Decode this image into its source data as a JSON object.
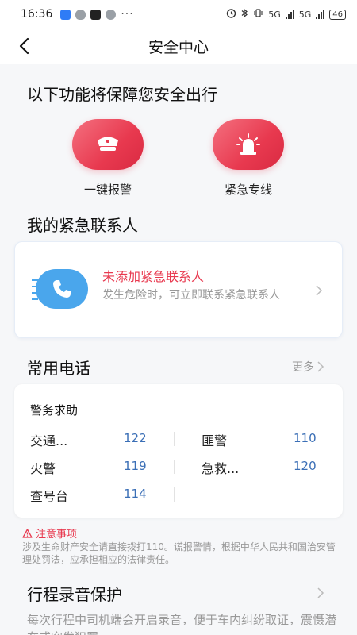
{
  "status_bar": {
    "time": "16:36",
    "dots": "···",
    "net1": "5G",
    "net2": "5G",
    "battery": "46"
  },
  "nav": {
    "title": "安全中心"
  },
  "features": {
    "heading": "以下功能将保障您安全出行",
    "items": [
      {
        "label": "一键报警",
        "icon": "police-cap-icon"
      },
      {
        "label": "紧急专线",
        "icon": "siren-icon"
      }
    ]
  },
  "contacts": {
    "heading": "我的紧急联系人",
    "empty_title": "未添加紧急联系人",
    "empty_desc": "发生危险时，可立即联系紧急联系人"
  },
  "phones": {
    "heading": "常用电话",
    "more": "更多",
    "card_title": "警务求助",
    "items": [
      {
        "name": "交通...",
        "number": "122"
      },
      {
        "name": "匪警",
        "number": "110"
      },
      {
        "name": "火警",
        "number": "119"
      },
      {
        "name": "急救...",
        "number": "120"
      },
      {
        "name": "查号台",
        "number": "114"
      }
    ]
  },
  "notice": {
    "title": "注意事项",
    "text": "涉及生命财产安全请直接拨打110。谎报警情，根据中华人民共和国治安管理处罚法，应承担相应的法律责任。"
  },
  "recording": {
    "heading": "行程录音保护",
    "text": "每次行程中司机端会开启录音，便于车内纠纷取证，震慑潜在或突发犯罪"
  },
  "colors": {
    "accent_red": "#e8394f",
    "phone_blue": "#4aa6ec",
    "number_blue": "#3b6fb6"
  }
}
